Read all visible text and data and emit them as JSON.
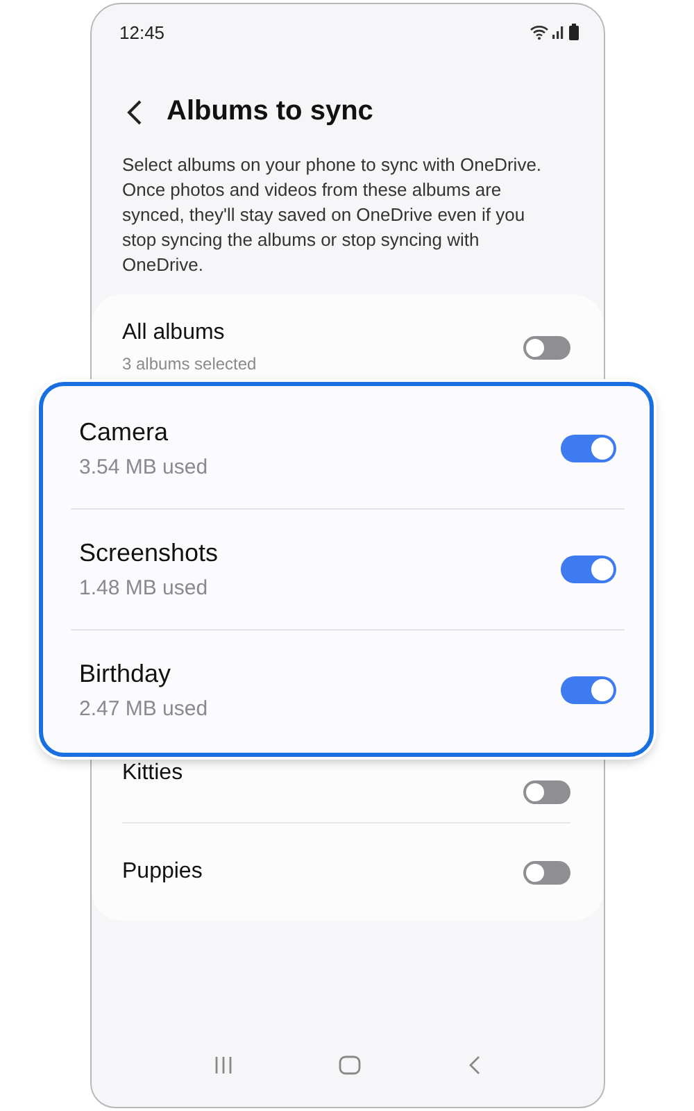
{
  "status_bar": {
    "time": "12:45"
  },
  "header": {
    "title": "Albums to sync"
  },
  "description": "Select albums on your phone to sync with OneDrive. Once photos and videos from these albums are synced, they'll stay saved on OneDrive even if you stop syncing the albums or stop syncing with OneDrive.",
  "all_albums": {
    "label": "All albums",
    "subtitle": "3 albums selected",
    "on": false
  },
  "highlighted_albums": [
    {
      "name": "Camera",
      "size": "3.54 MB used",
      "on": true
    },
    {
      "name": "Screenshots",
      "size": "1.48 MB used",
      "on": true
    },
    {
      "name": "Birthday",
      "size": "2.47 MB used",
      "on": true
    }
  ],
  "other_albums": [
    {
      "name": "Kitties",
      "on": false
    },
    {
      "name": "Puppies",
      "on": false
    }
  ]
}
